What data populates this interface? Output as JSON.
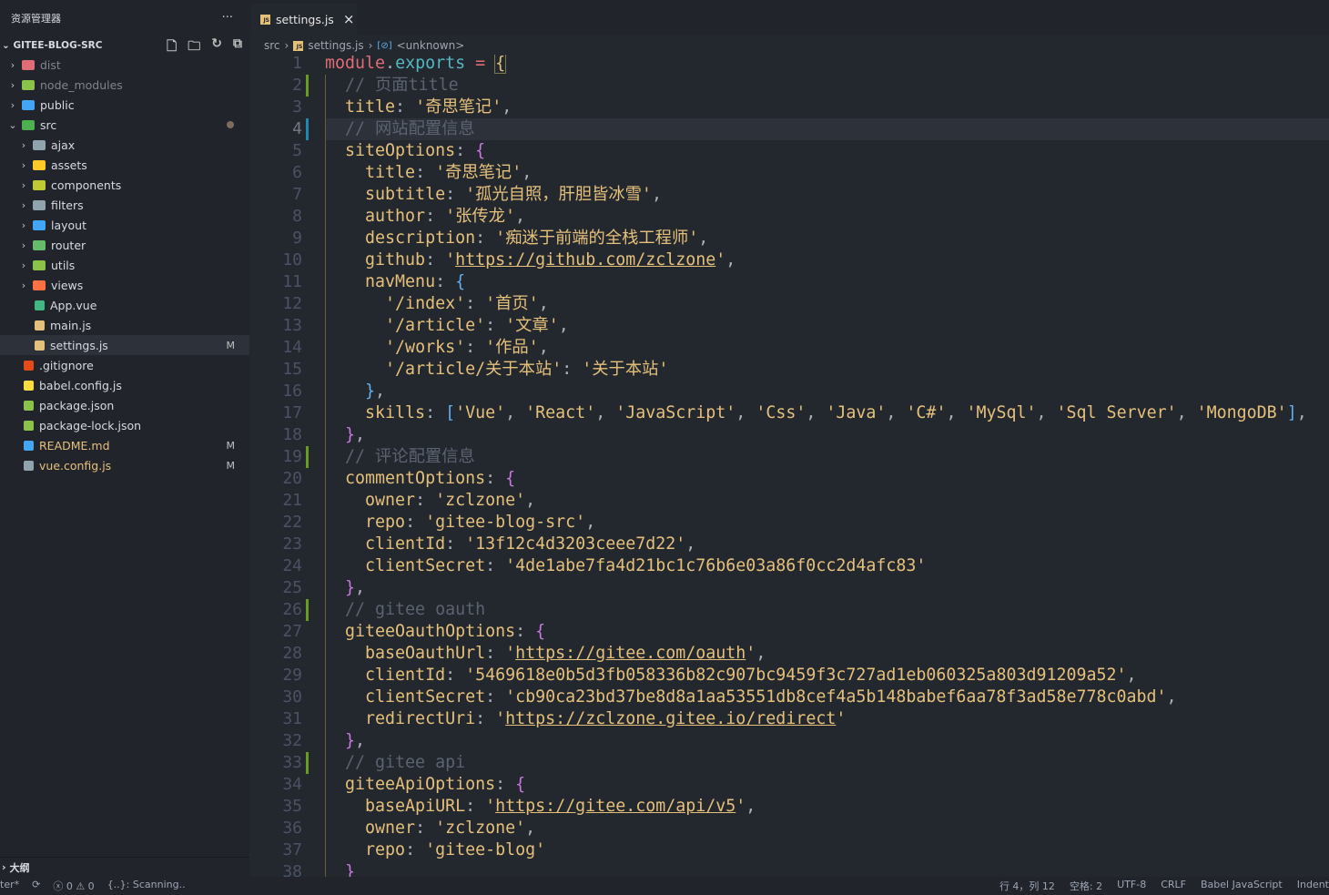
{
  "sidebar": {
    "title": "资源管理器",
    "more": "···",
    "project": "GITEE-BLOG-SRC",
    "items": [
      {
        "label": "dist",
        "level": 0,
        "chev": "right",
        "color": "#e06c75"
      },
      {
        "label": "node_modules",
        "level": 0,
        "chev": "right",
        "color": "#8bc34a"
      },
      {
        "label": "public",
        "level": 0,
        "chev": "right",
        "color": "#42a5f5"
      },
      {
        "label": "src",
        "level": 0,
        "chev": "down",
        "color": "#4caf50",
        "dot": true
      },
      {
        "label": "ajax",
        "level": 1,
        "chev": "right",
        "color": "#90a4ae"
      },
      {
        "label": "assets",
        "level": 1,
        "chev": "right",
        "color": "#ffca28"
      },
      {
        "label": "components",
        "level": 1,
        "chev": "right",
        "color": "#c0ca33"
      },
      {
        "label": "filters",
        "level": 1,
        "chev": "right",
        "color": "#90a4ae"
      },
      {
        "label": "layout",
        "level": 1,
        "chev": "right",
        "color": "#42a5f5"
      },
      {
        "label": "router",
        "level": 1,
        "chev": "right",
        "color": "#66bb6a"
      },
      {
        "label": "utils",
        "level": 1,
        "chev": "right",
        "color": "#8bc34a"
      },
      {
        "label": "views",
        "level": 1,
        "chev": "right",
        "color": "#ff7043"
      },
      {
        "label": "App.vue",
        "level": 1,
        "chev": "",
        "color": "#41b883",
        "icon": "vue-icon"
      },
      {
        "label": "main.js",
        "level": 1,
        "chev": "",
        "color": "#e5c07b",
        "icon": "js-icon"
      },
      {
        "label": "settings.js",
        "level": 1,
        "chev": "",
        "color": "#e5c07b",
        "icon": "js-icon",
        "badge": "M",
        "selected": true
      },
      {
        "label": ".gitignore",
        "level": 0,
        "chev": "",
        "color": "#e64a19",
        "icon": "git-icon"
      },
      {
        "label": "babel.config.js",
        "level": 0,
        "chev": "",
        "color": "#f9dc3e",
        "icon": "babel-icon"
      },
      {
        "label": "package.json",
        "level": 0,
        "chev": "",
        "color": "#8bc34a",
        "icon": "npm-icon"
      },
      {
        "label": "package-lock.json",
        "level": 0,
        "chev": "",
        "color": "#8bc34a",
        "icon": "npm-icon"
      },
      {
        "label": "README.md",
        "level": 0,
        "chev": "",
        "color": "#42a5f5",
        "icon": "info-icon",
        "badge": "M"
      },
      {
        "label": "vue.config.js",
        "level": 0,
        "chev": "",
        "color": "#90a4ae",
        "icon": "config-icon",
        "badge": "M"
      }
    ],
    "outline": "大纲"
  },
  "tab": {
    "label": "settings.js",
    "close": "×"
  },
  "breadcrumb": [
    "src",
    "settings.js",
    "<unknown>"
  ],
  "editor": {
    "current_line": 4,
    "git_markers": {
      "2": "#6a9a1f",
      "4": "#1e88b0",
      "19": "#6a9a1f",
      "26": "#6a9a1f",
      "33": "#6a9a1f"
    },
    "lines": [
      [
        [
          "r",
          "module"
        ],
        [
          "p",
          "."
        ],
        [
          "cy",
          "exports"
        ],
        [
          "p",
          " "
        ],
        [
          "r",
          "="
        ],
        [
          "p",
          " "
        ],
        [
          "by",
          "{"
        ]
      ],
      [
        [
          "c",
          "  // 页面title"
        ]
      ],
      [
        [
          "p",
          "  "
        ],
        [
          "k",
          "title"
        ],
        [
          "p",
          ": "
        ],
        [
          "s",
          "'奇思笔记'"
        ],
        [
          "p",
          ","
        ]
      ],
      [
        [
          "c",
          "  // 网站配置信息"
        ]
      ],
      [
        [
          "p",
          "  "
        ],
        [
          "k",
          "siteOptions"
        ],
        [
          "p",
          ": "
        ],
        [
          "b1",
          "{"
        ]
      ],
      [
        [
          "p",
          "    "
        ],
        [
          "k",
          "title"
        ],
        [
          "p",
          ": "
        ],
        [
          "s",
          "'奇思笔记'"
        ],
        [
          "p",
          ","
        ]
      ],
      [
        [
          "p",
          "    "
        ],
        [
          "k",
          "subtitle"
        ],
        [
          "p",
          ": "
        ],
        [
          "s",
          "'孤光自照，肝胆皆冰雪'"
        ],
        [
          "p",
          ","
        ]
      ],
      [
        [
          "p",
          "    "
        ],
        [
          "k",
          "author"
        ],
        [
          "p",
          ": "
        ],
        [
          "s",
          "'张传龙'"
        ],
        [
          "p",
          ","
        ]
      ],
      [
        [
          "p",
          "    "
        ],
        [
          "k",
          "description"
        ],
        [
          "p",
          ": "
        ],
        [
          "s",
          "'痴迷于前端的全栈工程师'"
        ],
        [
          "p",
          ","
        ]
      ],
      [
        [
          "p",
          "    "
        ],
        [
          "k",
          "github"
        ],
        [
          "p",
          ": "
        ],
        [
          "s",
          "'"
        ],
        [
          "u",
          "https://github.com/zclzone"
        ],
        [
          "s",
          "'"
        ],
        [
          "p",
          ","
        ]
      ],
      [
        [
          "p",
          "    "
        ],
        [
          "k",
          "navMenu"
        ],
        [
          "p",
          ": "
        ],
        [
          "b2",
          "{"
        ]
      ],
      [
        [
          "p",
          "      "
        ],
        [
          "s",
          "'/index'"
        ],
        [
          "p",
          ": "
        ],
        [
          "s",
          "'首页'"
        ],
        [
          "p",
          ","
        ]
      ],
      [
        [
          "p",
          "      "
        ],
        [
          "s",
          "'/article'"
        ],
        [
          "p",
          ": "
        ],
        [
          "s",
          "'文章'"
        ],
        [
          "p",
          ","
        ]
      ],
      [
        [
          "p",
          "      "
        ],
        [
          "s",
          "'/works'"
        ],
        [
          "p",
          ": "
        ],
        [
          "s",
          "'作品'"
        ],
        [
          "p",
          ","
        ]
      ],
      [
        [
          "p",
          "      "
        ],
        [
          "s",
          "'/article/关于本站'"
        ],
        [
          "p",
          ": "
        ],
        [
          "s",
          "'关于本站'"
        ]
      ],
      [
        [
          "p",
          "    "
        ],
        [
          "b2",
          "}"
        ],
        [
          "p",
          ","
        ]
      ],
      [
        [
          "p",
          "    "
        ],
        [
          "k",
          "skills"
        ],
        [
          "p",
          ": "
        ],
        [
          "b2",
          "["
        ],
        [
          "s",
          "'Vue'"
        ],
        [
          "p",
          ", "
        ],
        [
          "s",
          "'React'"
        ],
        [
          "p",
          ", "
        ],
        [
          "s",
          "'JavaScript'"
        ],
        [
          "p",
          ", "
        ],
        [
          "s",
          "'Css'"
        ],
        [
          "p",
          ", "
        ],
        [
          "s",
          "'Java'"
        ],
        [
          "p",
          ", "
        ],
        [
          "s",
          "'C#'"
        ],
        [
          "p",
          ", "
        ],
        [
          "s",
          "'MySql'"
        ],
        [
          "p",
          ", "
        ],
        [
          "s",
          "'Sql Server'"
        ],
        [
          "p",
          ", "
        ],
        [
          "s",
          "'MongoDB'"
        ],
        [
          "b2",
          "]"
        ],
        [
          "p",
          ","
        ]
      ],
      [
        [
          "p",
          "  "
        ],
        [
          "b1",
          "}"
        ],
        [
          "p",
          ","
        ]
      ],
      [
        [
          "c",
          "  // 评论配置信息"
        ]
      ],
      [
        [
          "p",
          "  "
        ],
        [
          "k",
          "commentOptions"
        ],
        [
          "p",
          ": "
        ],
        [
          "b1",
          "{"
        ]
      ],
      [
        [
          "p",
          "    "
        ],
        [
          "k",
          "owner"
        ],
        [
          "p",
          ": "
        ],
        [
          "s",
          "'zclzone'"
        ],
        [
          "p",
          ","
        ]
      ],
      [
        [
          "p",
          "    "
        ],
        [
          "k",
          "repo"
        ],
        [
          "p",
          ": "
        ],
        [
          "s",
          "'gitee-blog-src'"
        ],
        [
          "p",
          ","
        ]
      ],
      [
        [
          "p",
          "    "
        ],
        [
          "k",
          "clientId"
        ],
        [
          "p",
          ": "
        ],
        [
          "s",
          "'13f12c4d3203ceee7d22'"
        ],
        [
          "p",
          ","
        ]
      ],
      [
        [
          "p",
          "    "
        ],
        [
          "k",
          "clientSecret"
        ],
        [
          "p",
          ": "
        ],
        [
          "s",
          "'4de1abe7fa4d21bc1c76b6e03a86f0cc2d4afc83'"
        ]
      ],
      [
        [
          "p",
          "  "
        ],
        [
          "b1",
          "}"
        ],
        [
          "p",
          ","
        ]
      ],
      [
        [
          "c",
          "  // gitee oauth"
        ]
      ],
      [
        [
          "p",
          "  "
        ],
        [
          "k",
          "giteeOauthOptions"
        ],
        [
          "p",
          ": "
        ],
        [
          "b1",
          "{"
        ]
      ],
      [
        [
          "p",
          "    "
        ],
        [
          "k",
          "baseOauthUrl"
        ],
        [
          "p",
          ": "
        ],
        [
          "s",
          "'"
        ],
        [
          "u",
          "https://gitee.com/oauth"
        ],
        [
          "s",
          "'"
        ],
        [
          "p",
          ","
        ]
      ],
      [
        [
          "p",
          "    "
        ],
        [
          "k",
          "clientId"
        ],
        [
          "p",
          ": "
        ],
        [
          "s",
          "'5469618e0b5d3fb058336b82c907bc9459f3c727ad1eb060325a803d91209a52'"
        ],
        [
          "p",
          ","
        ]
      ],
      [
        [
          "p",
          "    "
        ],
        [
          "k",
          "clientSecret"
        ],
        [
          "p",
          ": "
        ],
        [
          "s",
          "'cb90ca23bd37be8d8a1aa53551db8cef4a5b148babef6aa78f3ad58e778c0abd'"
        ],
        [
          "p",
          ","
        ]
      ],
      [
        [
          "p",
          "    "
        ],
        [
          "k",
          "redirectUri"
        ],
        [
          "p",
          ": "
        ],
        [
          "s",
          "'"
        ],
        [
          "u",
          "https://zclzone.gitee.io/redirect"
        ],
        [
          "s",
          "'"
        ]
      ],
      [
        [
          "p",
          "  "
        ],
        [
          "b1",
          "}"
        ],
        [
          "p",
          ","
        ]
      ],
      [
        [
          "c",
          "  // gitee api"
        ]
      ],
      [
        [
          "p",
          "  "
        ],
        [
          "k",
          "giteeApiOptions"
        ],
        [
          "p",
          ": "
        ],
        [
          "b1",
          "{"
        ]
      ],
      [
        [
          "p",
          "    "
        ],
        [
          "k",
          "baseApiURL"
        ],
        [
          "p",
          ": "
        ],
        [
          "s",
          "'"
        ],
        [
          "u",
          "https://gitee.com/api/v5"
        ],
        [
          "s",
          "'"
        ],
        [
          "p",
          ","
        ]
      ],
      [
        [
          "p",
          "    "
        ],
        [
          "k",
          "owner"
        ],
        [
          "p",
          ": "
        ],
        [
          "s",
          "'zclzone'"
        ],
        [
          "p",
          ","
        ]
      ],
      [
        [
          "p",
          "    "
        ],
        [
          "k",
          "repo"
        ],
        [
          "p",
          ": "
        ],
        [
          "s",
          "'gitee-blog'"
        ]
      ],
      [
        [
          "p",
          "  "
        ],
        [
          "b1",
          "}"
        ]
      ]
    ]
  },
  "status": {
    "left": [
      "ter*",
      "⟳",
      "ⓧ 0 ⚠ 0",
      "{..}: Scanning.."
    ],
    "right": [
      "行 4，列 12",
      "空格: 2",
      "UTF-8",
      "CRLF",
      "Babel JavaScript",
      "Indent"
    ]
  }
}
